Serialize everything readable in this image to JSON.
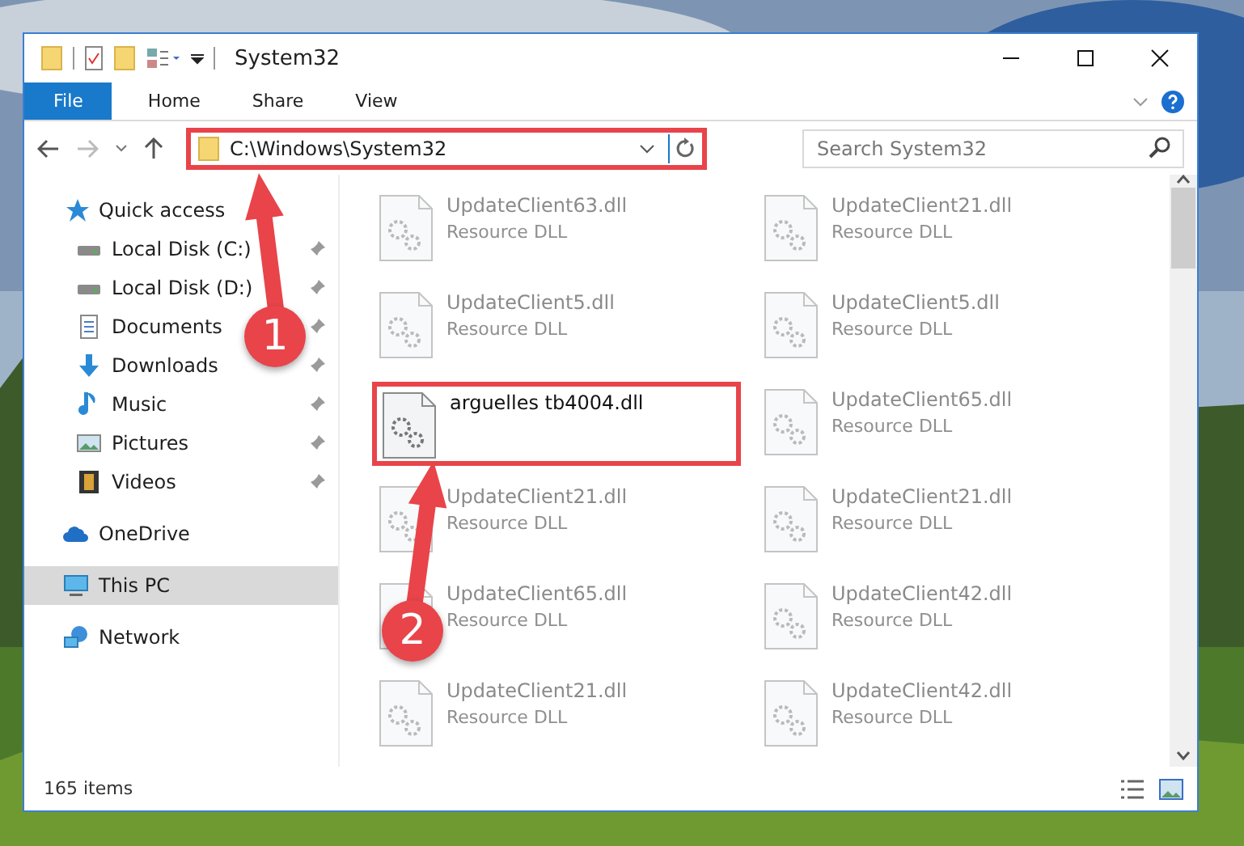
{
  "window": {
    "title": "System32"
  },
  "ribbon": {
    "tabs": [
      {
        "label": "File",
        "kind": "file"
      },
      {
        "label": "Home",
        "kind": "tab"
      },
      {
        "label": "Share",
        "kind": "tab"
      },
      {
        "label": "View",
        "kind": "tab"
      }
    ]
  },
  "address": {
    "path": "C:\\Windows\\System32",
    "highlighted": true
  },
  "search": {
    "placeholder": "Search System32"
  },
  "sidebar": {
    "items": [
      {
        "label": "Quick access",
        "kind": "star",
        "selected": false,
        "children": [
          {
            "label": "Local Disk (C:)",
            "kind": "disk",
            "pinned": true,
            "selected": false
          },
          {
            "label": "Local Disk (D:)",
            "kind": "disk",
            "pinned": true,
            "selected": false
          },
          {
            "label": "Documents",
            "kind": "documents",
            "pinned": true,
            "selected": false
          },
          {
            "label": "Downloads",
            "kind": "downloads",
            "pinned": true,
            "selected": false
          },
          {
            "label": "Music",
            "kind": "music",
            "pinned": true,
            "selected": false
          },
          {
            "label": "Pictures",
            "kind": "pictures",
            "pinned": true,
            "selected": false
          },
          {
            "label": "Videos",
            "kind": "videos",
            "pinned": true,
            "selected": false
          }
        ]
      },
      {
        "label": "OneDrive",
        "kind": "cloud",
        "selected": false
      },
      {
        "label": "This PC",
        "kind": "pc",
        "selected": true
      },
      {
        "label": "Network",
        "kind": "network",
        "selected": false
      }
    ]
  },
  "files": [
    {
      "name": "UpdateClient63.dll",
      "type": "Resource DLL",
      "blurred": true,
      "highlighted": false
    },
    {
      "name": "UpdateClient21.dll",
      "type": "Resource DLL",
      "blurred": true,
      "highlighted": false
    },
    {
      "name": "UpdateClient5.dll",
      "type": "Resource DLL",
      "blurred": true,
      "highlighted": false
    },
    {
      "name": "UpdateClient5.dll",
      "type": "Resource DLL",
      "blurred": true,
      "highlighted": false
    },
    {
      "name": "arguelles tb4004.dll",
      "blurred": false,
      "highlighted": true
    },
    {
      "name": "UpdateClient65.dll",
      "type": "Resource DLL",
      "blurred": true,
      "highlighted": false
    },
    {
      "name": "UpdateClient21.dll",
      "type": "Resource DLL",
      "blurred": true,
      "highlighted": false
    },
    {
      "name": "UpdateClient21.dll",
      "type": "Resource DLL",
      "blurred": true,
      "highlighted": false
    },
    {
      "name": "UpdateClient65.dll",
      "type": "Resource DLL",
      "blurred": true,
      "highlighted": false
    },
    {
      "name": "UpdateClient42.dll",
      "type": "Resource DLL",
      "blurred": true,
      "highlighted": false
    },
    {
      "name": "UpdateClient21.dll",
      "type": "Resource DLL",
      "blurred": true,
      "highlighted": false
    },
    {
      "name": "UpdateClient42.dll",
      "type": "Resource DLL",
      "blurred": true,
      "highlighted": false
    }
  ],
  "annotations": [
    {
      "label": "1"
    },
    {
      "label": "2"
    }
  ],
  "status_bar": {
    "count": "165 items"
  }
}
